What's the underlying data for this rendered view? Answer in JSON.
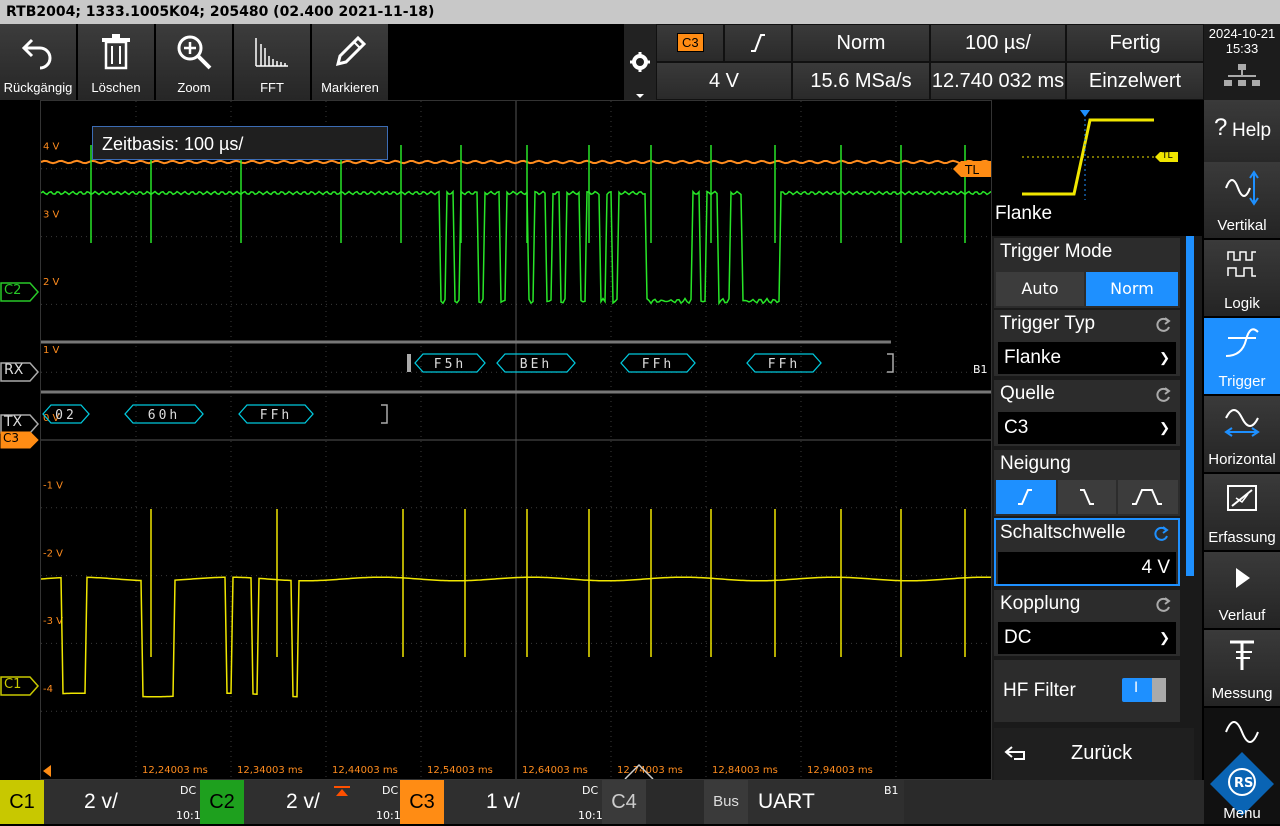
{
  "titlebar": {
    "text": "RTB2004; 1333.1005K04; 205480 (02.400 2021-11-18)"
  },
  "toolbar": [
    {
      "label": "Rückgängig",
      "icon": "undo-icon"
    },
    {
      "label": "Löschen",
      "icon": "trash-icon"
    },
    {
      "label": "Zoom",
      "icon": "zoom-icon"
    },
    {
      "label": "FFT",
      "icon": "fft-icon"
    },
    {
      "label": "Markieren",
      "icon": "pencil-icon"
    }
  ],
  "header": {
    "source_chip": "C3",
    "trigger_mode": "Norm",
    "timebase": "100 µs/",
    "status": "Fertig",
    "level": "4 V",
    "sample_rate": "15.6 MSa/s",
    "position": "12.740 032 ms",
    "acq_mode": "Einzelwert",
    "date": "2024-10-21",
    "time": "15:33"
  },
  "plot": {
    "tooltip": "Zeitbasis: 100 µs/",
    "y_labels": [
      "4 V",
      "3 V",
      "2 V",
      "1 V",
      "0 V",
      "-1 V",
      "-2 V",
      "-3 V",
      "-4"
    ],
    "x_labels": [
      "12,24003 ms",
      "12,34003 ms",
      "12,44003 ms",
      "12,54003 ms",
      "12,64003 ms",
      "12,74003 ms",
      "12,84003 ms",
      "12,94003 ms"
    ],
    "trigger_level_marker": "TL",
    "rx_label": "RX",
    "tx_label": "TX",
    "rx_bytes": [
      "F5h",
      "BEh",
      "FFh",
      "FFh"
    ],
    "tx_bytes": [
      "02",
      "60h",
      "FFh"
    ],
    "bus_marker": "B1",
    "ch2_marker": "C2",
    "ch3_marker": "C3",
    "ch1_marker": "C1"
  },
  "trigger_panel": {
    "diagram_label": "Flanke",
    "diagram_tl": "TL",
    "mode_title": "Trigger Mode",
    "mode_auto": "Auto",
    "mode_norm": "Norm",
    "type_title": "Trigger Typ",
    "type_value": "Flanke",
    "source_title": "Quelle",
    "source_value": "C3",
    "slope_title": "Neigung",
    "threshold_title": "Schaltschwelle",
    "threshold_value": "4 V",
    "coupling_title": "Kopplung",
    "coupling_value": "DC",
    "hf_title": "HF Filter",
    "hf_state": "I",
    "back_label": "Zurück"
  },
  "sidebar": [
    {
      "label": "Help",
      "icon": "help-icon"
    },
    {
      "label": "Vertikal",
      "icon": "vertical-icon"
    },
    {
      "label": "Logik",
      "icon": "logic-icon"
    },
    {
      "label": "Trigger",
      "icon": "trigger-icon"
    },
    {
      "label": "Horizontal",
      "icon": "horizontal-icon"
    },
    {
      "label": "Erfassung",
      "icon": "acquisition-icon"
    },
    {
      "label": "Verlauf",
      "icon": "play-icon"
    },
    {
      "label": "Messung",
      "icon": "measure-icon"
    },
    {
      "label": "Menu",
      "icon": "menu-logo-icon"
    }
  ],
  "bottombar": {
    "ch1": {
      "tag": "C1",
      "scale": "2 v/",
      "coupling": "DC",
      "imp": "10:1",
      "color": "#c8c800"
    },
    "ch2": {
      "tag": "C2",
      "scale": "2 v/",
      "coupling": "DC",
      "imp": "10:1",
      "color": "#1ea01e"
    },
    "ch3": {
      "tag": "C3",
      "scale": "1 v/",
      "coupling": "DC",
      "imp": "10:1",
      "color": "#ff8c14"
    },
    "ch4": {
      "tag": "C4"
    },
    "bus": {
      "tag": "Bus",
      "name": "UART",
      "id": "B1"
    }
  },
  "colors": {
    "ch1": "#f0e600",
    "ch2": "#28e628",
    "ch3": "#ff8c1e",
    "accent": "#1e90ff",
    "bus": "#00c8dc"
  }
}
